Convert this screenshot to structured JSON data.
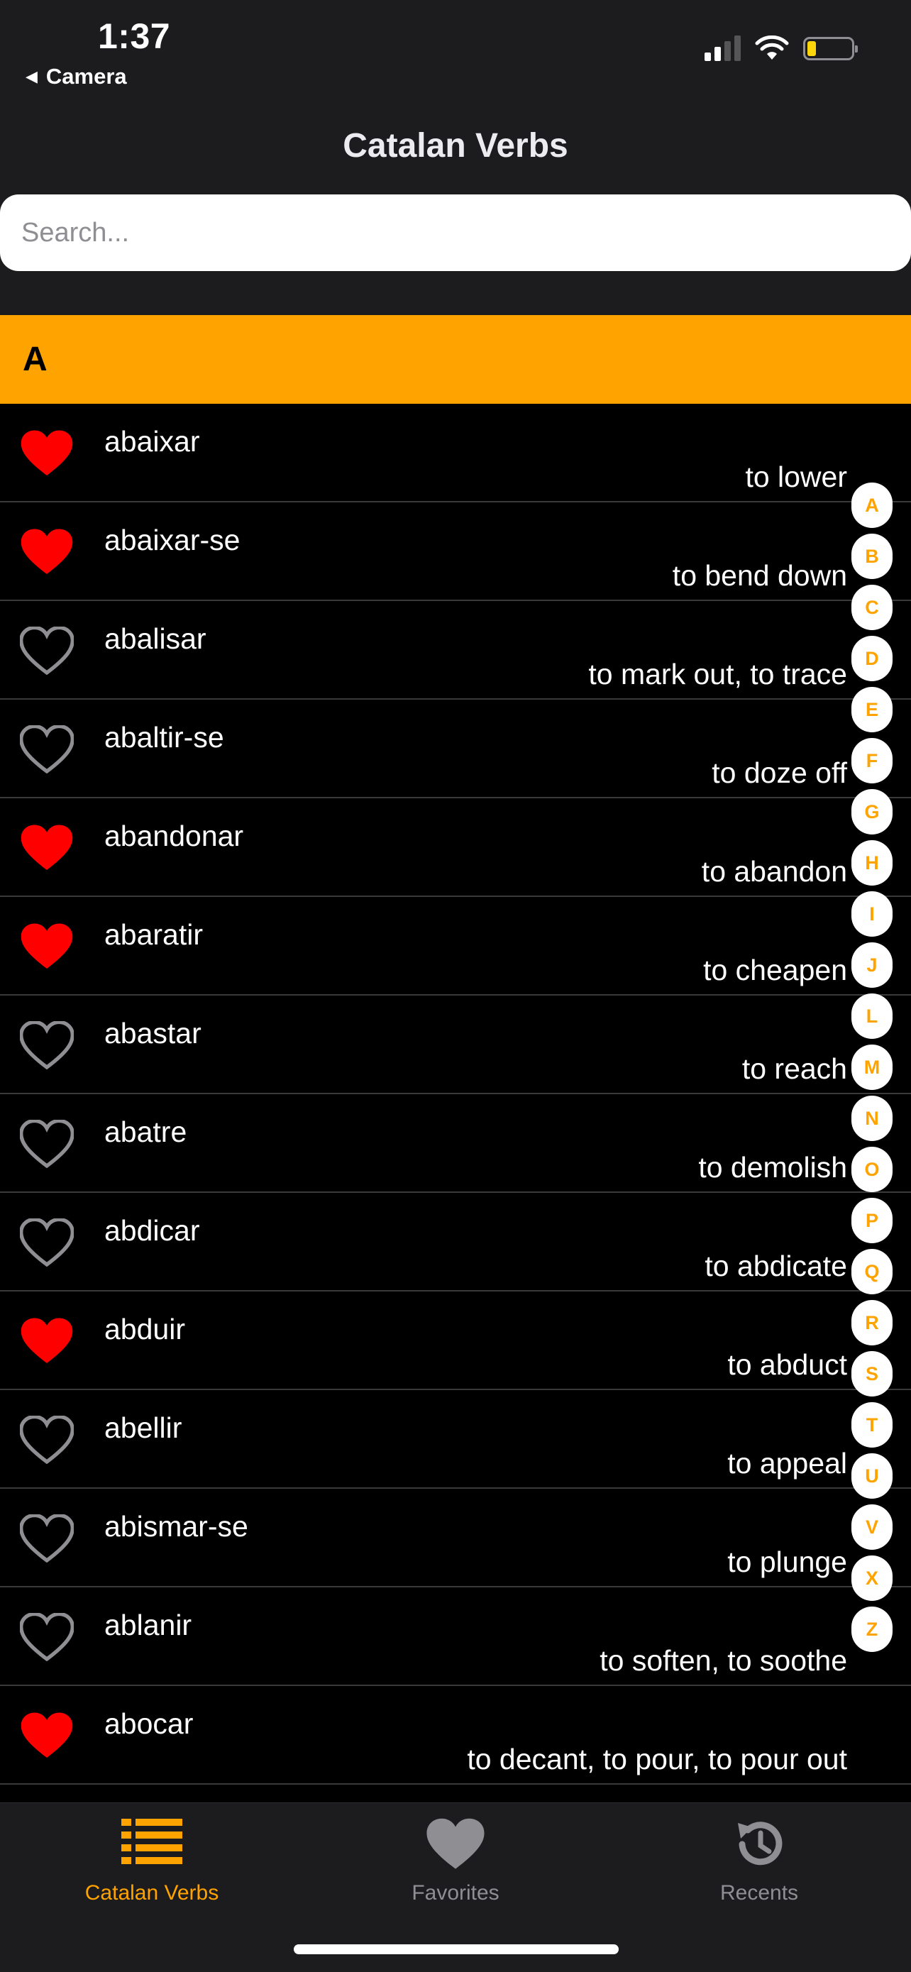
{
  "status_bar": {
    "time": "1:37",
    "back_app": "Camera"
  },
  "nav": {
    "title": "Catalan Verbs"
  },
  "search": {
    "placeholder": "Search..."
  },
  "section": {
    "letter": "A"
  },
  "verbs": [
    {
      "verb": "abaixar",
      "meaning": "to lower",
      "favorite": true
    },
    {
      "verb": "abaixar-se",
      "meaning": "to bend down",
      "favorite": true
    },
    {
      "verb": "abalisar",
      "meaning": "to mark out, to trace",
      "favorite": false
    },
    {
      "verb": "abaltir-se",
      "meaning": "to doze off",
      "favorite": false
    },
    {
      "verb": "abandonar",
      "meaning": "to abandon",
      "favorite": true
    },
    {
      "verb": "abaratir",
      "meaning": "to cheapen",
      "favorite": true
    },
    {
      "verb": "abastar",
      "meaning": "to reach",
      "favorite": false
    },
    {
      "verb": "abatre",
      "meaning": "to demolish",
      "favorite": false
    },
    {
      "verb": "abdicar",
      "meaning": "to abdicate",
      "favorite": false
    },
    {
      "verb": "abduir",
      "meaning": "to abduct",
      "favorite": true
    },
    {
      "verb": "abellir",
      "meaning": "to appeal",
      "favorite": false
    },
    {
      "verb": "abismar-se",
      "meaning": "to plunge",
      "favorite": false
    },
    {
      "verb": "ablanir",
      "meaning": "to soften, to soothe",
      "favorite": false
    },
    {
      "verb": "abocar",
      "meaning": "to decant, to pour, to pour out",
      "favorite": true
    }
  ],
  "index_letters": [
    "A",
    "B",
    "C",
    "D",
    "E",
    "F",
    "G",
    "H",
    "I",
    "J",
    "L",
    "M",
    "N",
    "O",
    "P",
    "Q",
    "R",
    "S",
    "T",
    "U",
    "V",
    "X",
    "Z"
  ],
  "tabs": [
    {
      "label": "Catalan Verbs",
      "icon": "list-icon",
      "active": true
    },
    {
      "label": "Favorites",
      "icon": "heart-icon",
      "active": false
    },
    {
      "label": "Recents",
      "icon": "history-icon",
      "active": false
    }
  ],
  "colors": {
    "accent": "#ffa300",
    "favorite": "#ff0000",
    "background": "#000000",
    "bar": "#1c1c1e",
    "inactive": "#8e8e93"
  }
}
